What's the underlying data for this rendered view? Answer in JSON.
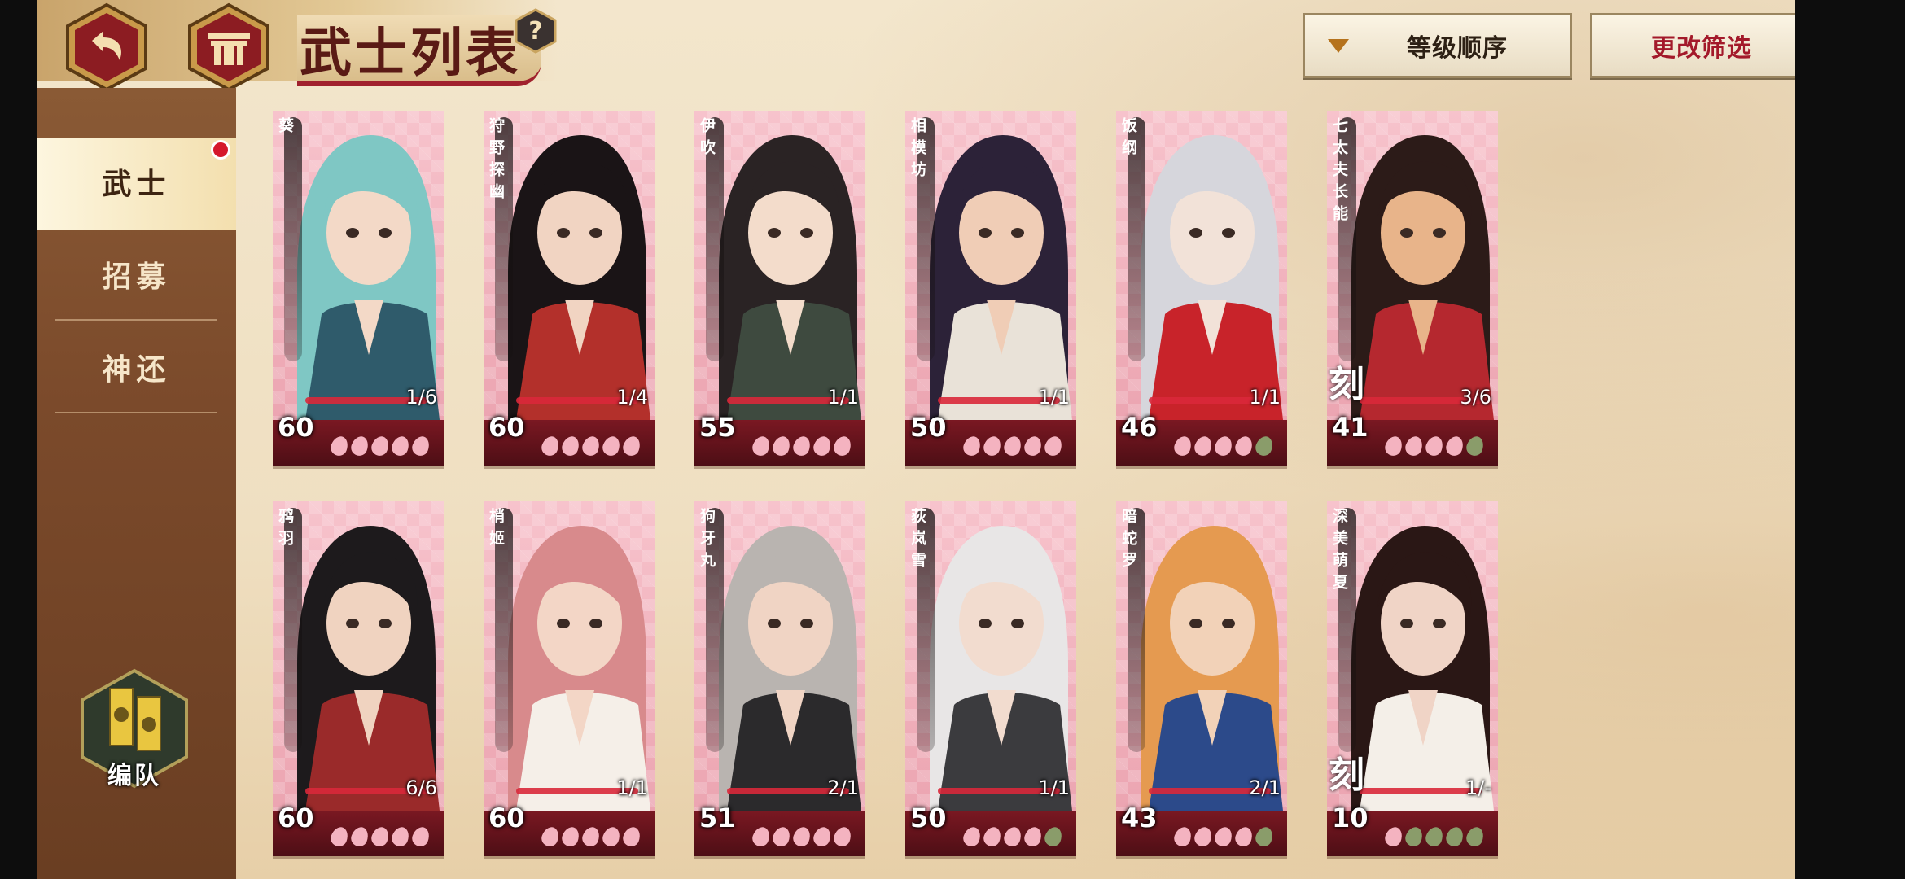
{
  "header": {
    "title": "武士列表",
    "help": "?",
    "sort_label": "等级顺序",
    "filter_label": "更改筛选"
  },
  "sidebar": {
    "items": [
      {
        "label": "武士",
        "active": true,
        "has_badge": true
      },
      {
        "label": "招募",
        "active": false
      },
      {
        "label": "神还",
        "active": false
      }
    ],
    "team_label": "编队"
  },
  "cards": [
    {
      "name": "葵",
      "level": "60",
      "count": "1/6",
      "mark": "",
      "stars": 5,
      "max_stars": 5,
      "palette": [
        "#7fc7c4",
        "#2f5b6b",
        "#f3d9c7"
      ]
    },
    {
      "name": "狩野探幽",
      "level": "60",
      "count": "1/4",
      "mark": "",
      "stars": 5,
      "max_stars": 5,
      "palette": [
        "#1a1416",
        "#b3302b",
        "#f1d4c2"
      ]
    },
    {
      "name": "伊吹",
      "level": "55",
      "count": "1/1",
      "mark": "",
      "stars": 5,
      "max_stars": 5,
      "palette": [
        "#2a2324",
        "#3e4a3f",
        "#f3dccb"
      ]
    },
    {
      "name": "相模坊",
      "level": "50",
      "count": "1/1",
      "mark": "",
      "stars": 5,
      "max_stars": 5,
      "palette": [
        "#2c2238",
        "#e9e2d8",
        "#f0cdb6"
      ]
    },
    {
      "name": "饭纲",
      "level": "46",
      "count": "1/1",
      "mark": "",
      "stars": 4,
      "max_stars": 5,
      "palette": [
        "#d6d6dc",
        "#c8232a",
        "#f2e2d8"
      ]
    },
    {
      "name": "七太夫长能",
      "level": "41",
      "count": "3/6",
      "mark": "刻",
      "stars": 4,
      "max_stars": 5,
      "palette": [
        "#2c1b18",
        "#b5282f",
        "#e8b48a"
      ]
    },
    {
      "name": "鸦羽",
      "level": "60",
      "count": "6/6",
      "mark": "",
      "stars": 5,
      "max_stars": 5,
      "palette": [
        "#1d1a1c",
        "#9a2a2a",
        "#f0d3c0"
      ]
    },
    {
      "name": "梢姬",
      "level": "60",
      "count": "1/1",
      "mark": "",
      "stars": 5,
      "max_stars": 5,
      "palette": [
        "#d88a8c",
        "#f5efe8",
        "#f3d6c6"
      ]
    },
    {
      "name": "狗牙丸",
      "level": "51",
      "count": "2/1",
      "mark": "",
      "stars": 5,
      "max_stars": 5,
      "palette": [
        "#b9b4b0",
        "#2b2a2c",
        "#f0d4c4"
      ]
    },
    {
      "name": "荻岚雪",
      "level": "50",
      "count": "1/1",
      "mark": "",
      "stars": 4,
      "max_stars": 5,
      "palette": [
        "#e8e6e6",
        "#3b3b3e",
        "#f2dccf"
      ]
    },
    {
      "name": "暗蛇罗",
      "level": "43",
      "count": "2/1",
      "mark": "",
      "stars": 4,
      "max_stars": 5,
      "palette": [
        "#e59a50",
        "#2c4a8a",
        "#f2d2b8"
      ]
    },
    {
      "name": "深美萌夏",
      "level": "10",
      "count": "1/-",
      "mark": "刻",
      "stars": 1,
      "max_stars": 5,
      "palette": [
        "#2a1715",
        "#f4efe8",
        "#f0d4c6"
      ]
    }
  ]
}
